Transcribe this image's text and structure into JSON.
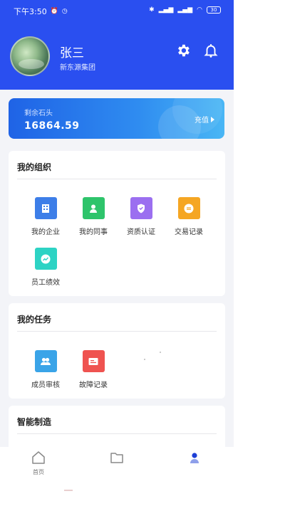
{
  "status_bar": {
    "time": "下午3:50",
    "battery": "30"
  },
  "profile": {
    "name": "张三",
    "org": "新东源集团"
  },
  "balance": {
    "label": "剩余石头",
    "value": "16864.59",
    "action_label": "充值"
  },
  "sections": {
    "org": {
      "title": "我的组织",
      "items": [
        {
          "label": "我的企业",
          "icon": "building-icon",
          "color": "#3d7ee8"
        },
        {
          "label": "我的同事",
          "icon": "person-icon",
          "color": "#2ec46b"
        },
        {
          "label": "资质认证",
          "icon": "certificate-icon",
          "color": "#9b6ff0"
        },
        {
          "label": "交易记录",
          "icon": "chat-record-icon",
          "color": "#f5a623"
        },
        {
          "label": "员工绩效",
          "icon": "performance-icon",
          "color": "#2dd3c4"
        }
      ]
    },
    "tasks": {
      "title": "我的任务",
      "items": [
        {
          "label": "成员审核",
          "icon": "member-review-icon",
          "color": "#3aa4e8"
        },
        {
          "label": "故障记录",
          "icon": "fault-record-icon",
          "color": "#ef5350"
        }
      ]
    },
    "manufacturing": {
      "title": "智能制造"
    }
  },
  "nav": {
    "home_label": "首页"
  },
  "colors": {
    "header": "#2a4ff0",
    "background": "#f3f4f8"
  }
}
